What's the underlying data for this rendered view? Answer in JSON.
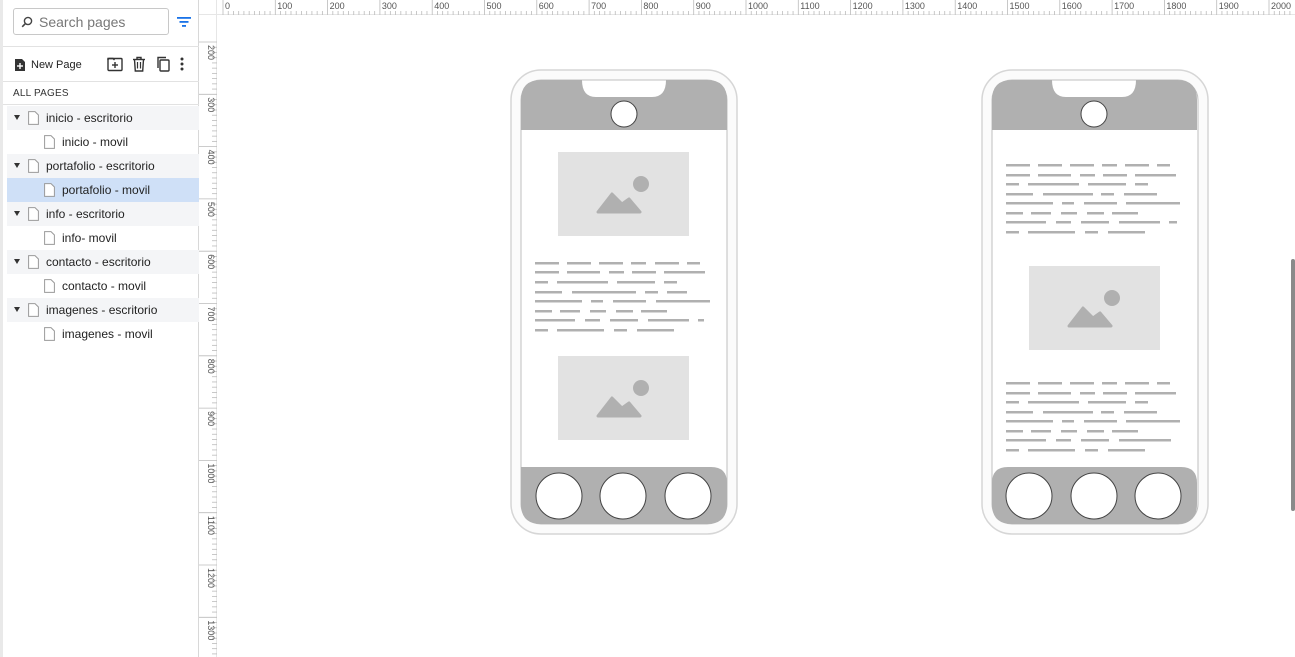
{
  "search": {
    "placeholder": "Search pages"
  },
  "toolbar": {
    "new_page_label": "New Page"
  },
  "section_label": "ALL PAGES",
  "pages": [
    {
      "label": "inicio - escritorio",
      "level": "parent"
    },
    {
      "label": "inicio - movil",
      "level": "child"
    },
    {
      "label": "portafolio - escritorio",
      "level": "parent"
    },
    {
      "label": "portafolio - movil",
      "level": "child",
      "selected": true
    },
    {
      "label": "info - escritorio",
      "level": "parent"
    },
    {
      "label": "info- movil",
      "level": "child"
    },
    {
      "label": "contacto - escritorio",
      "level": "parent"
    },
    {
      "label": "contacto - movil",
      "level": "child"
    },
    {
      "label": "imagenes - escritorio",
      "level": "parent"
    },
    {
      "label": "imagenes - movil",
      "level": "child"
    }
  ],
  "ruler": {
    "top_labels": [
      "0",
      "100",
      "200",
      "300",
      "400",
      "500",
      "600",
      "700",
      "800",
      "900",
      "1000",
      "1100",
      "1200",
      "1300",
      "1400",
      "1500",
      "1600",
      "1700",
      "1800",
      "1900",
      "2000"
    ],
    "left_labels": [
      "200",
      "300",
      "400",
      "500",
      "600",
      "700",
      "800",
      "900",
      "1000",
      "1100",
      "1200",
      "1300"
    ]
  },
  "colors": {
    "accent": "#1a73e8",
    "selected_row": "#cfe0f7",
    "wire_dark": "#b0b0b0",
    "wire_light": "#e2e2e2"
  },
  "icons": {
    "search": "search-icon",
    "filter": "filter-icon",
    "new_page": "new-page-icon",
    "add_folder": "add-folder-icon",
    "trash": "trash-icon",
    "duplicate": "duplicate-icon",
    "more": "more-icon"
  }
}
